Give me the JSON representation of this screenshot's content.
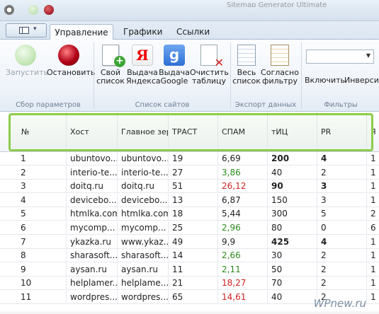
{
  "title_fragment": "Sitemap Generator Ultimate",
  "tabs": [
    "Управление",
    "Графики",
    "Ссылки"
  ],
  "ribbon": {
    "start": {
      "l1": "Запустить",
      "l2": ""
    },
    "stop": {
      "l1": "Остановить",
      "l2": ""
    },
    "own_list": {
      "l1": "Свой",
      "l2": "список"
    },
    "yandex": {
      "l1": "Выдача",
      "l2": "Яндекса",
      "glyph": "Я"
    },
    "google": {
      "l1": "Выдача",
      "l2": "Google",
      "glyph": "g"
    },
    "clear": {
      "l1": "Очистить",
      "l2": "таблицу"
    },
    "whole": {
      "l1": "Весь",
      "l2": "список"
    },
    "filtered": {
      "l1": "Согласно",
      "l2": "фильтру"
    },
    "enable": {
      "l1": "Включить",
      "l2": ""
    },
    "invert": {
      "l1": "Инверси",
      "l2": ""
    },
    "groups": {
      "params": "Сбор параметров",
      "sites": "Список сайтов",
      "export": "Экспорт данных",
      "filters": "Фильтры"
    }
  },
  "table": {
    "headers": [
      "№",
      "Хост",
      "Главное зеркало",
      "ТРАСТ",
      "СПАМ",
      "тИЦ",
      "PR",
      "Я И"
    ],
    "rows": [
      {
        "n": "1",
        "host": "ubuntovo...",
        "mirror": "ubuntovo...",
        "trust": "19",
        "spam": "6,69",
        "spam_color": "",
        "tic": "200",
        "tic_bold": true,
        "pr": "4",
        "pr_bold": true,
        "last": "1"
      },
      {
        "n": "2",
        "host": "interio-te...",
        "mirror": "interio-te...",
        "trust": "27",
        "spam": "3,86",
        "spam_color": "green",
        "tic": "40",
        "tic_bold": false,
        "pr": "2",
        "pr_bold": false,
        "last": "1"
      },
      {
        "n": "3",
        "host": "doitq.ru",
        "mirror": "doitq.ru",
        "trust": "51",
        "spam": "26,12",
        "spam_color": "red",
        "tic": "90",
        "tic_bold": true,
        "pr": "3",
        "pr_bold": true,
        "last": "1"
      },
      {
        "n": "4",
        "host": "devicebo...",
        "mirror": "devicebo...",
        "trust": "13",
        "spam": "6,87",
        "spam_color": "",
        "tic": "150",
        "tic_bold": false,
        "pr": "3",
        "pr_bold": false,
        "last": "1"
      },
      {
        "n": "5",
        "host": "htmlka.com",
        "mirror": "htmlka.com",
        "trust": "18",
        "spam": "5,44",
        "spam_color": "",
        "tic": "300",
        "tic_bold": false,
        "pr": "5",
        "pr_bold": false,
        "last": "2"
      },
      {
        "n": "6",
        "host": "mycomp...",
        "mirror": "mycomp...",
        "trust": "25",
        "spam": "2,96",
        "spam_color": "green",
        "tic": "80",
        "tic_bold": false,
        "pr": "0",
        "pr_bold": false,
        "last": "6"
      },
      {
        "n": "7",
        "host": "ykazka.ru",
        "mirror": "www.ykaz...",
        "trust": "49",
        "spam": "9,9",
        "spam_color": "",
        "tic": "425",
        "tic_bold": true,
        "pr": "4",
        "pr_bold": true,
        "last": "1"
      },
      {
        "n": "8",
        "host": "sharasoft...",
        "mirror": "sharasoft...",
        "trust": "14",
        "spam": "2,66",
        "spam_color": "green",
        "tic": "30",
        "tic_bold": false,
        "pr": "2",
        "pr_bold": false,
        "last": "1"
      },
      {
        "n": "9",
        "host": "aysan.ru",
        "mirror": "aysan.ru",
        "trust": "11",
        "spam": "2,11",
        "spam_color": "green",
        "tic": "50",
        "tic_bold": false,
        "pr": "2",
        "pr_bold": false,
        "last": "1"
      },
      {
        "n": "10",
        "host": "helplamer...",
        "mirror": "helplame...",
        "trust": "21",
        "spam": "18,27",
        "spam_color": "red",
        "tic": "70",
        "tic_bold": false,
        "pr": "2",
        "pr_bold": false,
        "last": "1"
      },
      {
        "n": "11",
        "host": "wordpres...",
        "mirror": "wordpres...",
        "trust": "65",
        "spam": "14,61",
        "spam_color": "red",
        "tic": "40",
        "tic_bold": false,
        "pr": "2",
        "pr_bold": false,
        "last": "1"
      }
    ]
  },
  "watermark": "WPnew.ru"
}
